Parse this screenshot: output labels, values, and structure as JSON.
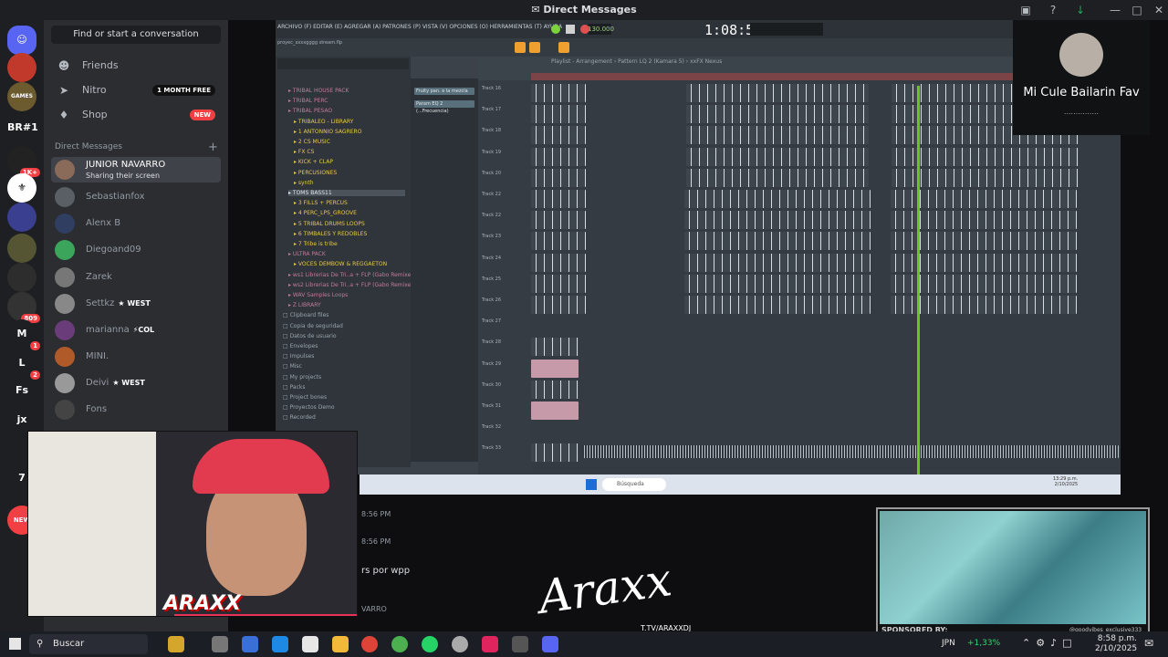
{
  "window": {
    "title": "Direct Messages"
  },
  "sidebar": {
    "find_placeholder": "Find or start a conversation",
    "nav": [
      {
        "label": "Friends",
        "icon": "friends-icon"
      },
      {
        "label": "Nitro",
        "icon": "nitro-icon",
        "badge": "1 MONTH FREE"
      },
      {
        "label": "Shop",
        "icon": "shop-icon",
        "badge": "NEW"
      }
    ],
    "dm_header": "Direct Messages",
    "dms": [
      {
        "name": "JUNIOR NAVARRO",
        "status": "Sharing their screen"
      },
      {
        "name": "Sebastianfox"
      },
      {
        "name": "Alenx B"
      },
      {
        "name": "Diegoand09"
      },
      {
        "name": "Zarek"
      },
      {
        "name": "Settkz",
        "badge": "WEST"
      },
      {
        "name": "marianna",
        "badge": "COL"
      },
      {
        "name": "MINI."
      },
      {
        "name": "Deivi",
        "badge": "WEST"
      },
      {
        "name": "Fons"
      }
    ]
  },
  "rail": {
    "servers": [
      "BR#1",
      "M",
      "L",
      "Fs",
      "jx",
      "7"
    ],
    "badges": [
      "1K+",
      "809",
      "1",
      "2",
      "NEW"
    ]
  },
  "fl": {
    "menu": "ARCHIVO (F) EDITAR (E) AGREGAR (A) PATRONES (P) VISTA (V) OPCIONES (O) HERRAMIENTAS (T) AYUDA",
    "project": "proyec_xxxxgggg stream.flp",
    "time": "1:08:50",
    "tempo": "130.000",
    "playlist_title": "Playlist - Arrangement › Pattern LQ 2 (Kamara 5) › xxFX Nexus",
    "channels": [
      "Fruity pan. e la mezcla",
      "Param EQ 2 (...Frecuencia)"
    ],
    "browser": [
      {
        "label": "TRIBAL HOUSE PACK",
        "c": "p"
      },
      {
        "label": "TRIBAL PERC",
        "c": "p"
      },
      {
        "label": "TRIBAL PESAO",
        "c": "p"
      },
      {
        "label": "TRIBALEO - LIBRARY",
        "c": "y"
      },
      {
        "label": "1 ANTONNIO SAGRERO",
        "c": "y"
      },
      {
        "label": "2 CS MUSIC",
        "c": "y"
      },
      {
        "label": "FX CS",
        "c": "y"
      },
      {
        "label": "KICK + CLAP",
        "c": "y"
      },
      {
        "label": "PERCUSIONES",
        "c": "y"
      },
      {
        "label": "synth",
        "c": "y"
      },
      {
        "label": "TOMS BASS11",
        "c": "sel"
      },
      {
        "label": "3 FILLS + PERCUS",
        "c": "y"
      },
      {
        "label": "4 PERC_LPS_GROOVE",
        "c": "y"
      },
      {
        "label": "5 TRIBAL DRUMS LOOPS",
        "c": "y"
      },
      {
        "label": "6 TIMBALES Y REDOBLES",
        "c": "y"
      },
      {
        "label": "7 Tribe is tribe",
        "c": "y"
      },
      {
        "label": "ULTRA PACK",
        "c": "p"
      },
      {
        "label": "VOCES DEMBOW & REGGAETON",
        "c": "y"
      },
      {
        "label": "ws1 Librerias De Tri..a + FLP (Gabo Remixes)",
        "c": "p"
      },
      {
        "label": "ws2 Librerias De Tri..a + FLP (Gabo Remixes)",
        "c": "p"
      },
      {
        "label": "WAV Samples Loops",
        "c": "p"
      },
      {
        "label": "Z LIBRARY",
        "c": "p"
      },
      {
        "label": "Clipboard files",
        "c": "g"
      },
      {
        "label": "Copia de seguridad",
        "c": "g"
      },
      {
        "label": "Datos de usuario",
        "c": "g"
      },
      {
        "label": "Envelopes",
        "c": "g"
      },
      {
        "label": "Impulses",
        "c": "g"
      },
      {
        "label": "Misc",
        "c": "g"
      },
      {
        "label": "My projects",
        "c": "g"
      },
      {
        "label": "Packs",
        "c": "g"
      },
      {
        "label": "Project bones",
        "c": "g"
      },
      {
        "label": "Proyectos Demo",
        "c": "g"
      },
      {
        "label": "Recorded",
        "c": "g"
      }
    ],
    "tracks": [
      "Track 16",
      "Track 17",
      "Track 18",
      "Track 19",
      "Track 20",
      "Track 22",
      "Track 22",
      "Track 23",
      "Track 24",
      "Track 25",
      "Track 26",
      "Track 27",
      "Track 28",
      "Track 29",
      "Track 30",
      "Track 31",
      "Track 32",
      "Track 33"
    ]
  },
  "stream_taskbar": {
    "search": "Búsqueda",
    "time": "13:29 p.m.",
    "date": "2/10/2025"
  },
  "chat": {
    "ts1": "8:56 PM",
    "ts2": "8:56 PM",
    "msg": "rs por wpp",
    "author": "VARRO"
  },
  "overlay": {
    "logo": "Araxx",
    "sub": "T.TV/ARAXXDJ",
    "cam_logo": "ARAXX",
    "sponsor": "SPONSORED BY:",
    "sponsor_handle": "@goodvibes_exclusive333"
  },
  "remote_user": {
    "name": "Mi Cule Bailarin Fav",
    "sub": "..............."
  },
  "taskbar": {
    "search": "Buscar",
    "weather": "JPN",
    "pct": "+1,33%",
    "time": "8:58 p.m.",
    "date": "2/10/2025"
  },
  "colors": {
    "accent": "#5865f2",
    "danger": "#f23f43",
    "playhead": "#6fd322"
  }
}
